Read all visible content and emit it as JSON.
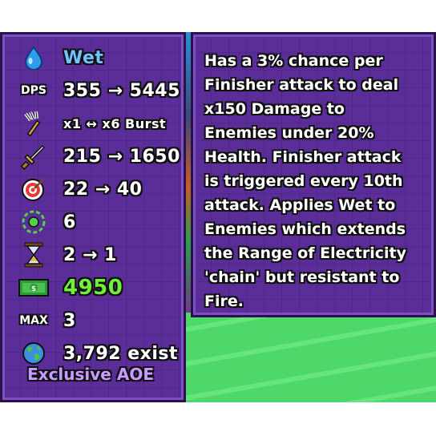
{
  "stats": {
    "element": "Wet",
    "dps": {
      "tag": "DPS",
      "value": "355 → 5445"
    },
    "burst": "x1 ↔ x6 Burst",
    "damage": "215 → 1650",
    "range": "22 → 40",
    "aoe_radius": "6",
    "cooldown": "2 → 1",
    "cost": "4950",
    "max": {
      "tag": "MAX",
      "value": "3"
    },
    "exist": "3,792 exist",
    "footer": "Exclusive AOE"
  },
  "description": "Has a 3% chance per\nFinisher attack to deal\nx150 Damage to\nEnemies under 20%\nHealth. Finisher attack\nis triggered every 10th\nattack. Applies Wet to\nEnemies which extends\nthe Range of Electricity\n'chain' but resistant to\nFire.",
  "colors": {
    "panel": "#5a2d99",
    "panel_border": "#2a1147",
    "element_text": "#6fc3ff",
    "cost_text": "#6ff03a",
    "footer_text": "#c79bff"
  },
  "icons": [
    "water-drop-icon",
    "dps-icon",
    "trident-burst-icon",
    "sword-icon",
    "target-icon",
    "aoe-ring-icon",
    "hourglass-icon",
    "cash-icon",
    "max-icon",
    "globe-icon"
  ]
}
